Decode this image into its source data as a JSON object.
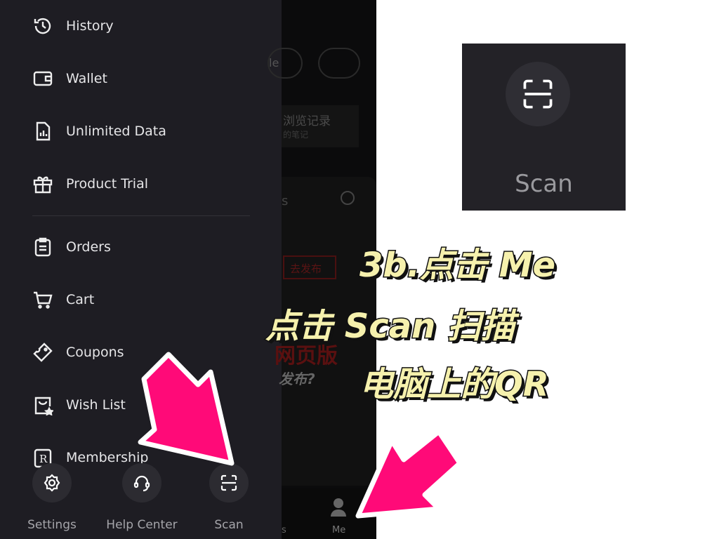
{
  "menu": {
    "items": [
      {
        "label": "History",
        "icon": "history-icon"
      },
      {
        "label": "Wallet",
        "icon": "wallet-icon"
      },
      {
        "label": "Unlimited Data",
        "icon": "data-icon"
      },
      {
        "label": "Product Trial",
        "icon": "gift-icon"
      },
      {
        "label": "Orders",
        "icon": "clipboard-icon"
      },
      {
        "label": "Cart",
        "icon": "cart-icon"
      },
      {
        "label": "Coupons",
        "icon": "coupon-icon"
      },
      {
        "label": "Wish List",
        "icon": "wishlist-icon"
      },
      {
        "label": "Membership",
        "icon": "membership-icon"
      }
    ]
  },
  "bottom": [
    {
      "label": "Settings"
    },
    {
      "label": "Help Center"
    },
    {
      "label": "Scan"
    }
  ],
  "background": {
    "pill_text": "le",
    "history_text": "浏览记录",
    "history_sub": "的笔记",
    "search_text": "s",
    "publish_btn": "去发布",
    "banner1": "网页版",
    "banner2": "发布?",
    "tab_left": "s",
    "tab_me": "Me"
  },
  "zoom_preview": {
    "label": "Scan"
  },
  "caption": {
    "line1": "3b.点击 Me",
    "line2": "点击 Scan 扫描",
    "line3": "电脑上的QR"
  },
  "colors": {
    "arrow": "#ff0a78",
    "caption": "#f6f1ad",
    "drawer": "#1e1d23"
  }
}
